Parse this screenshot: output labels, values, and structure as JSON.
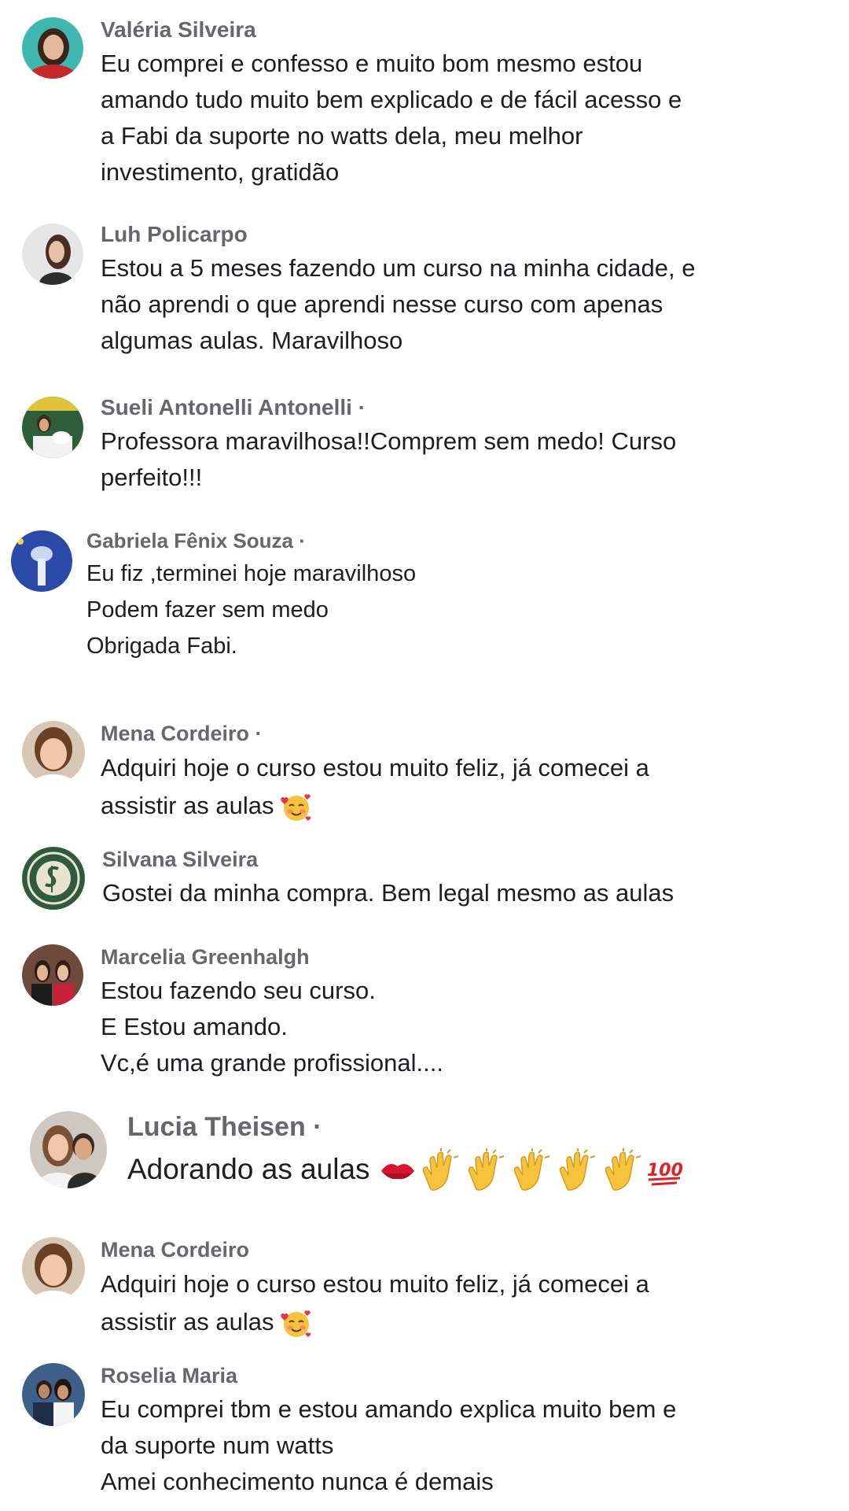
{
  "comments": [
    {
      "name": "Valéria Silveira",
      "text": "Eu comprei e confesso e muito bom mesmo estou\namando tudo muito bem explicado e de fácil acesso e\na Fabi da suporte no watts dela, meu melhor\ninvestimento, gratidão"
    },
    {
      "name": "Luh Policarpo",
      "text": "Estou a 5 meses fazendo um curso na minha cidade,  e\nnão aprendi o que aprendi nesse curso  com apenas\nalgumas aulas. Maravilhoso"
    },
    {
      "name": "Sueli Antonelli Antonelli",
      "separator": "·",
      "text": "Professora maravilhosa!!Comprem sem medo! Curso\nperfeito!!!"
    },
    {
      "name": "Gabriela Fênix Souza",
      "separator": "·",
      "text": "Eu fiz ,terminei hoje maravilhoso\nPodem fazer sem medo\nObrigada Fabi."
    },
    {
      "name": "Mena Cordeiro",
      "separator": "·",
      "text_line1": "Adquiri hoje o curso estou muito feliz, já comecei a",
      "text_line2": "assistir as aulas",
      "emoji": "smiling-face-with-hearts"
    },
    {
      "name": "Silvana Silveira",
      "text": "Gostei da minha compra.  Bem legal mesmo as aulas"
    },
    {
      "name": "Marcelia Greenhalgh",
      "text": "Estou fazendo seu curso.\nE Estou amando.\nVc,é uma grande profissional...."
    },
    {
      "name": "Lucia Theisen",
      "separator": "·",
      "text": "Adorando as aulas",
      "emojis": [
        "kiss-mark",
        "clapping-hands",
        "clapping-hands",
        "clapping-hands",
        "clapping-hands",
        "clapping-hands",
        "hundred-points"
      ]
    },
    {
      "name": "Mena Cordeiro",
      "text_line1": "Adquiri hoje o curso estou muito feliz, já comecei a",
      "text_line2": "assistir as aulas",
      "emoji": "smiling-face-with-hearts"
    },
    {
      "name": "Roselia Maria",
      "text": "Eu comprei tbm e estou amando explica muito bem e\nda suporte num watts\nAmei conhecimento nunca é demais"
    }
  ],
  "colors": {
    "name": "#65676b",
    "text": "#1c1e21",
    "background": "#ffffff"
  }
}
